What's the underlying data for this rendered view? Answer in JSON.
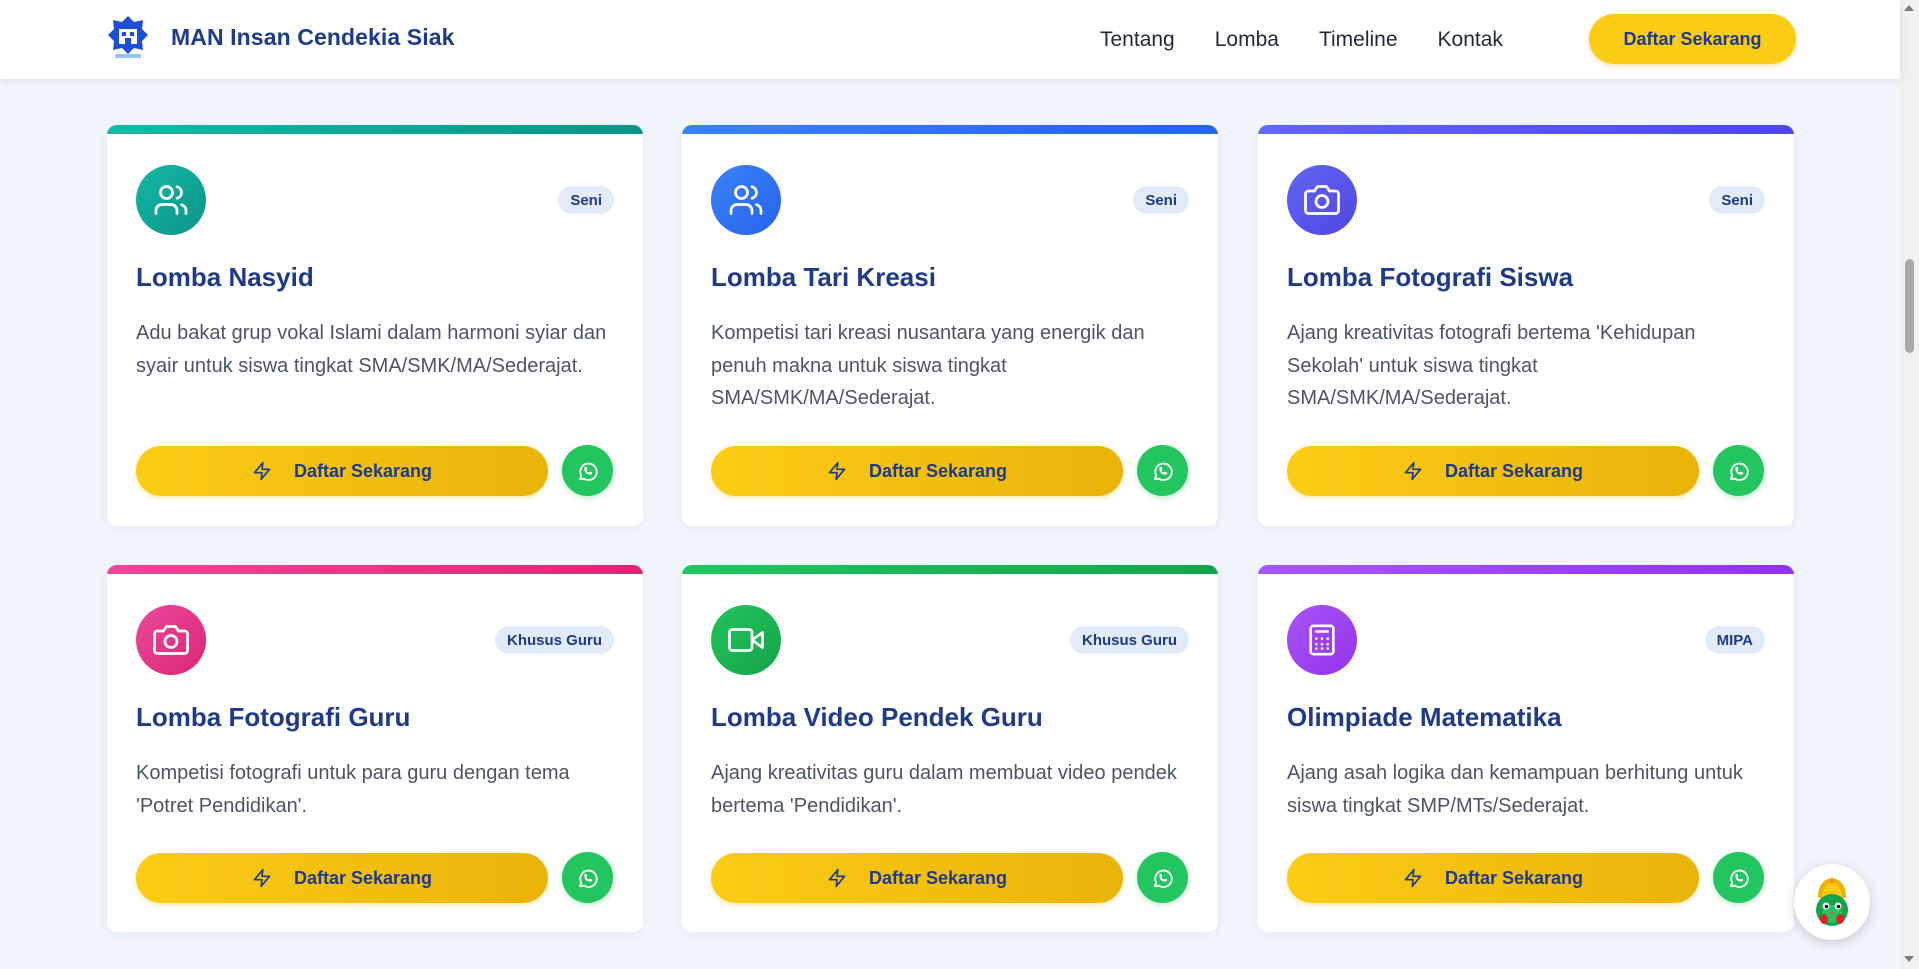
{
  "navbar": {
    "brand_name": "MAN Insan Cendekia Siak",
    "links": [
      "Tentang",
      "Lomba",
      "Timeline",
      "Kontak"
    ],
    "cta_label": "Daftar Sekarang"
  },
  "cards": [
    {
      "title": "Lomba Nasyid",
      "badge": "Seni",
      "description": "Adu bakat grup vokal Islami dalam harmoni syiar dan syair untuk siswa tingkat SMA/SMK/MA/Sederajat.",
      "button_label": "Daftar Sekarang",
      "icon": "users-icon",
      "accent_color": "#14b8a6"
    },
    {
      "title": "Lomba Tari Kreasi",
      "badge": "Seni",
      "description": "Kompetisi tari kreasi nusantara yang energik dan penuh makna untuk siswa tingkat SMA/SMK/MA/Sederajat.",
      "button_label": "Daftar Sekarang",
      "icon": "users-icon",
      "accent_color": "#3b82f6"
    },
    {
      "title": "Lomba Fotografi Siswa",
      "badge": "Seni",
      "description": "Ajang kreativitas fotografi bertema 'Kehidupan Sekolah' untuk siswa tingkat SMA/SMK/MA/Sederajat.",
      "button_label": "Daftar Sekarang",
      "icon": "camera-icon",
      "accent_color": "#6366f1"
    },
    {
      "title": "Lomba Fotografi Guru",
      "badge": "Khusus Guru",
      "description": "Kompetisi fotografi untuk para guru dengan tema 'Potret Pendidikan'.",
      "button_label": "Daftar Sekarang",
      "icon": "camera-icon",
      "accent_color": "#ec4899"
    },
    {
      "title": "Lomba Video Pendek Guru",
      "badge": "Khusus Guru",
      "description": "Ajang kreativitas guru dalam membuat video pendek bertema 'Pendidikan'.",
      "button_label": "Daftar Sekarang",
      "icon": "video-icon",
      "accent_color": "#22c55e"
    },
    {
      "title": "Olimpiade Matematika",
      "badge": "MIPA",
      "description": "Ajang asah logika dan kemampuan berhitung untuk siswa tingkat SMP/MTs/Sederajat.",
      "button_label": "Daftar Sekarang",
      "icon": "calculator-icon",
      "accent_color": "#a855f7"
    }
  ],
  "colors": {
    "brand_navy": "#1e3a8a",
    "cta_yellow": "#facc15",
    "whatsapp_green": "#22c55e",
    "page_bg": "#f1f5fc"
  }
}
